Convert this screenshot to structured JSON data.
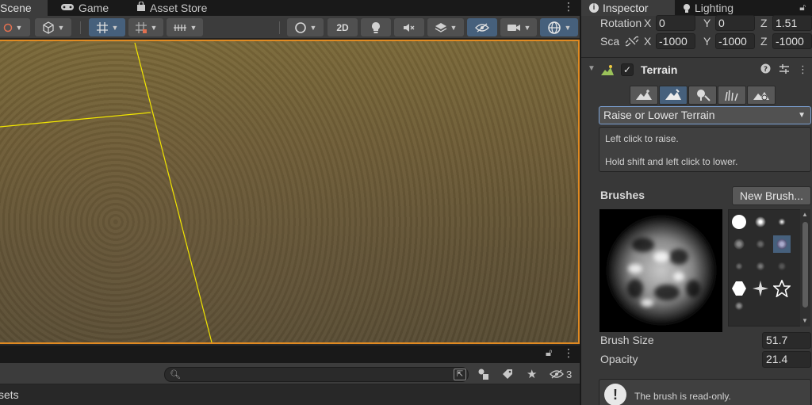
{
  "scene_panel": {
    "tabs": [
      {
        "label": "Scene",
        "icon": "hash-icon"
      },
      {
        "label": "Game",
        "icon": "gamepad-icon"
      },
      {
        "label": "Asset Store",
        "icon": "bag-icon"
      }
    ],
    "toolbar": {
      "mode_2d_label": "2D"
    },
    "lower_panel": {
      "hidden_count": "3",
      "assets_label": "sets"
    }
  },
  "inspector": {
    "tabs": [
      {
        "label": "Inspector",
        "icon": "info-icon"
      },
      {
        "label": "Lighting",
        "icon": "bulb-icon"
      }
    ],
    "transform": {
      "rotation": {
        "label": "Rotation",
        "x_axis": "X",
        "x": "0",
        "y_axis": "Y",
        "y": "0",
        "z_axis": "Z",
        "z": "1.51"
      },
      "scale": {
        "label": "Sca",
        "x_axis": "X",
        "x": "-1000",
        "y_axis": "Y",
        "y": "-1000",
        "z_axis": "Z",
        "z": "-1000"
      }
    },
    "terrain": {
      "component_title": "Terrain",
      "enabled_mark": "✓",
      "tool_dropdown": "Raise or Lower Terrain",
      "help_lines": [
        "Left click to raise.",
        "Hold shift and left click to lower."
      ],
      "brushes_label": "Brushes",
      "new_brush_label": "New Brush...",
      "brush_size_label": "Brush Size",
      "brush_size_value": "51.7",
      "opacity_label": "Opacity",
      "opacity_value": "21.4",
      "readonly_message": "The brush is read-only."
    }
  },
  "colors": {
    "accent_selected": "#46607c",
    "viewport_outline": "#e08a22",
    "terrain_grid": "#f2e600"
  }
}
